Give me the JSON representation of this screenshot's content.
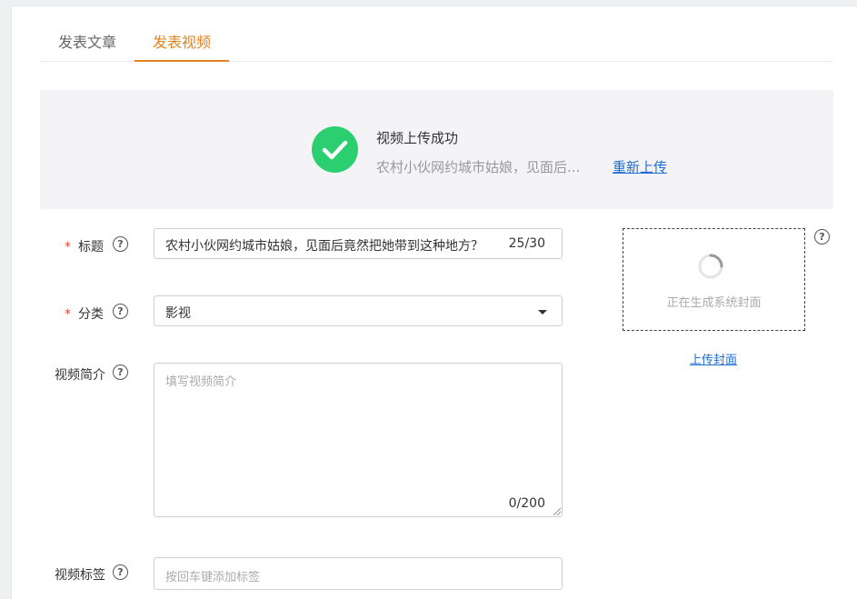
{
  "tabs": [
    {
      "label": "发表文章",
      "active": false
    },
    {
      "label": "发表视频",
      "active": true
    }
  ],
  "upload_banner": {
    "status": "视频上传成功",
    "filename": "农村小伙网约城市姑娘，见面后...",
    "reupload_label": "重新上传"
  },
  "form": {
    "title": {
      "label": "标题",
      "required": true,
      "value": "农村小伙网约城市姑娘，见面后竟然把她带到这种地方？",
      "count": "25/30"
    },
    "category": {
      "label": "分类",
      "required": true,
      "value": "影视"
    },
    "description": {
      "label": "视频简介",
      "placeholder": "填写视频简介",
      "count": "0/200"
    },
    "tags": {
      "label": "视频标签",
      "placeholder": "按回车键添加标签"
    }
  },
  "cover": {
    "status_text": "正在生成系统封面",
    "upload_label": "上传封面"
  },
  "help_glyph": "?",
  "required_mark": "*",
  "colors": {
    "accent": "#e6821e",
    "success": "#2bcf70",
    "link": "#1f6fd0",
    "required": "#e8473d"
  }
}
